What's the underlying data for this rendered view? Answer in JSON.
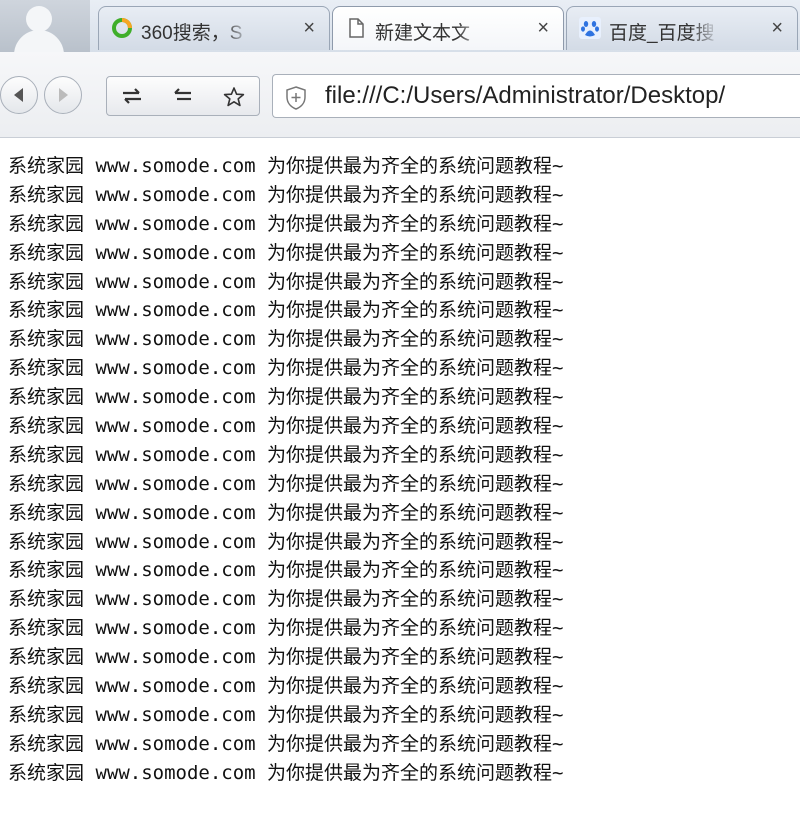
{
  "tabs": [
    {
      "title": "360搜索，S",
      "icon": "360-search-icon",
      "active": false
    },
    {
      "title": "新建文本文",
      "icon": "document-icon",
      "active": true
    },
    {
      "title": "百度_百度搜",
      "icon": "baidu-paw-icon",
      "active": false
    }
  ],
  "tab_close_glyph": "×",
  "toolbar": {
    "url": "file:///C:/Users/Administrator/Desktop/"
  },
  "content": {
    "lines": [
      "系统家园 www.somode.com 为你提供最为齐全的系统问题教程~",
      "系统家园 www.somode.com 为你提供最为齐全的系统问题教程~",
      "系统家园 www.somode.com 为你提供最为齐全的系统问题教程~",
      "系统家园 www.somode.com 为你提供最为齐全的系统问题教程~",
      "系统家园 www.somode.com 为你提供最为齐全的系统问题教程~",
      "系统家园 www.somode.com 为你提供最为齐全的系统问题教程~",
      "系统家园 www.somode.com 为你提供最为齐全的系统问题教程~",
      "系统家园 www.somode.com 为你提供最为齐全的系统问题教程~",
      "系统家园 www.somode.com 为你提供最为齐全的系统问题教程~",
      "系统家园 www.somode.com 为你提供最为齐全的系统问题教程~",
      "系统家园 www.somode.com 为你提供最为齐全的系统问题教程~",
      "系统家园 www.somode.com 为你提供最为齐全的系统问题教程~",
      "系统家园 www.somode.com 为你提供最为齐全的系统问题教程~",
      "系统家园 www.somode.com 为你提供最为齐全的系统问题教程~",
      "系统家园 www.somode.com 为你提供最为齐全的系统问题教程~",
      "系统家园 www.somode.com 为你提供最为齐全的系统问题教程~",
      "系统家园 www.somode.com 为你提供最为齐全的系统问题教程~",
      "系统家园 www.somode.com 为你提供最为齐全的系统问题教程~",
      "系统家园 www.somode.com 为你提供最为齐全的系统问题教程~",
      "系统家园 www.somode.com 为你提供最为齐全的系统问题教程~",
      "系统家园 www.somode.com 为你提供最为齐全的系统问题教程~",
      "系统家园 www.somode.com 为你提供最为齐全的系统问题教程~"
    ]
  },
  "colors": {
    "tab_strip": "#dde4ee",
    "active_tab": "#ffffff",
    "search_360_green": "#3fae2a",
    "search_360_orange": "#f5a623",
    "baidu_blue": "#2f73e0",
    "text": "#111111"
  }
}
